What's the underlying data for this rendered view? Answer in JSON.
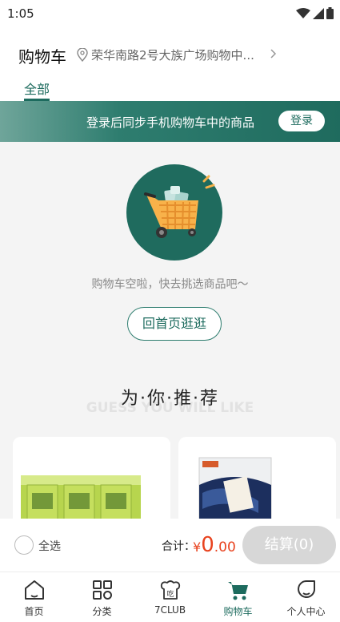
{
  "status_bar": {
    "time": "1:05"
  },
  "header": {
    "title": "购物车",
    "location": "荣华南路2号大族广场购物中...",
    "tabs": [
      {
        "label": "全部",
        "active": true
      }
    ]
  },
  "login_banner": {
    "text": "登录后同步手机购物车中的商品",
    "button_label": "登录"
  },
  "empty_state": {
    "message": "购物车空啦，快去挑选商品吧～",
    "button_label": "回首页逛逛"
  },
  "recommend": {
    "title": "为·你·推·荐",
    "subtitle": "GUESS YOU WILL LIKE"
  },
  "checkout": {
    "select_all_label": "全选",
    "total_label": "合计：",
    "currency": "¥",
    "amount_int": "0",
    "amount_dec": ".00",
    "button_label": "结算(0)"
  },
  "bottom_nav": [
    {
      "label": "首页",
      "icon": "home-icon"
    },
    {
      "label": "分类",
      "icon": "category-icon"
    },
    {
      "label": "7CLUB",
      "icon": "club-icon"
    },
    {
      "label": "购物车",
      "icon": "cart-icon",
      "active": true
    },
    {
      "label": "个人中心",
      "icon": "profile-icon"
    }
  ],
  "colors": {
    "brand": "#1d6b5e",
    "price": "#e8421e",
    "background": "#f4f4f4"
  }
}
